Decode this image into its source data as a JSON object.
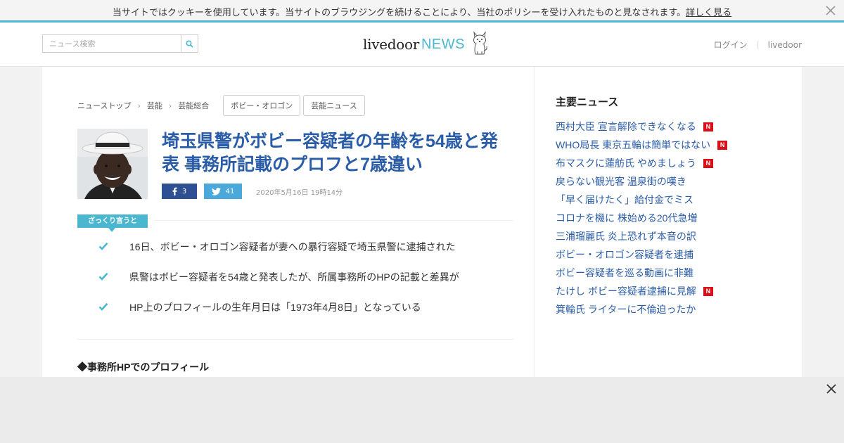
{
  "cookie": {
    "message": "当サイトではクッキーを使用しています。当サイトのブラウジングを続けることにより、当社のポリシーを受け入れたものと見なされます。",
    "link": "詳しく見る",
    "close_icon": "close-icon"
  },
  "header": {
    "search_placeholder": "ニュース検索",
    "search_icon": "search-icon",
    "logo_main": "livedoor",
    "logo_news": "NEWS",
    "logo_icon": "dog-mascot-icon",
    "login": "ログイン",
    "livedoor_link": "livedoor"
  },
  "breadcrumb": {
    "items": [
      "ニューストップ",
      "芸能",
      "芸能総合"
    ],
    "tags": [
      "ボビー・オロゴン",
      "芸能ニュース"
    ]
  },
  "article": {
    "title": "埼玉県警がボビー容疑者の年齢を54歳と発表 事務所記載のプロフと7歳違い",
    "facebook_count": "3",
    "twitter_count": "41",
    "date": "2020年5月16日 19時14分",
    "summary_label": "ざっくり言うと",
    "summary": [
      "16日、ボビー・オロゴン容疑者が妻への暴行容疑で埼玉県警に逮捕された",
      "県警はボビー容疑者を54歳と発表したが、所属事務所のHPの記載と差異が",
      "HP上のプロフィールの生年月日は「1973年4月8日」となっている"
    ],
    "section_heading": "◆事務所HPでのプロフィール"
  },
  "sidebar": {
    "title": "主要ニュース",
    "items": [
      {
        "label": "西村大臣 宣言解除できなくなる",
        "new": true
      },
      {
        "label": "WHO局長 東京五輪は簡単ではない",
        "new": true
      },
      {
        "label": "布マスクに蓮舫氏 やめましょう",
        "new": true
      },
      {
        "label": "戻らない観光客 温泉街の嘆き",
        "new": false
      },
      {
        "label": "「早く届けたく」給付金でミス",
        "new": false
      },
      {
        "label": "コロナを機に 株始める20代急増",
        "new": false
      },
      {
        "label": "三浦瑠麗氏 炎上恐れず本音の訳",
        "new": false
      },
      {
        "label": "ボビー・オロゴン容疑者を逮捕",
        "new": false
      },
      {
        "label": "ボビー容疑者を巡る動画に非難",
        "new": false
      },
      {
        "label": "たけし ボビー容疑者逮捕に見解",
        "new": true
      },
      {
        "label": "箕輪氏 ライターに不倫迫ったか",
        "new": false
      }
    ],
    "new_badge": "N"
  },
  "colors": {
    "accent": "#4ab6cf",
    "title_link": "#2a5ca8",
    "facebook": "#2f4f93",
    "twitter": "#4aa9da",
    "new_badge": "#d9101a"
  }
}
